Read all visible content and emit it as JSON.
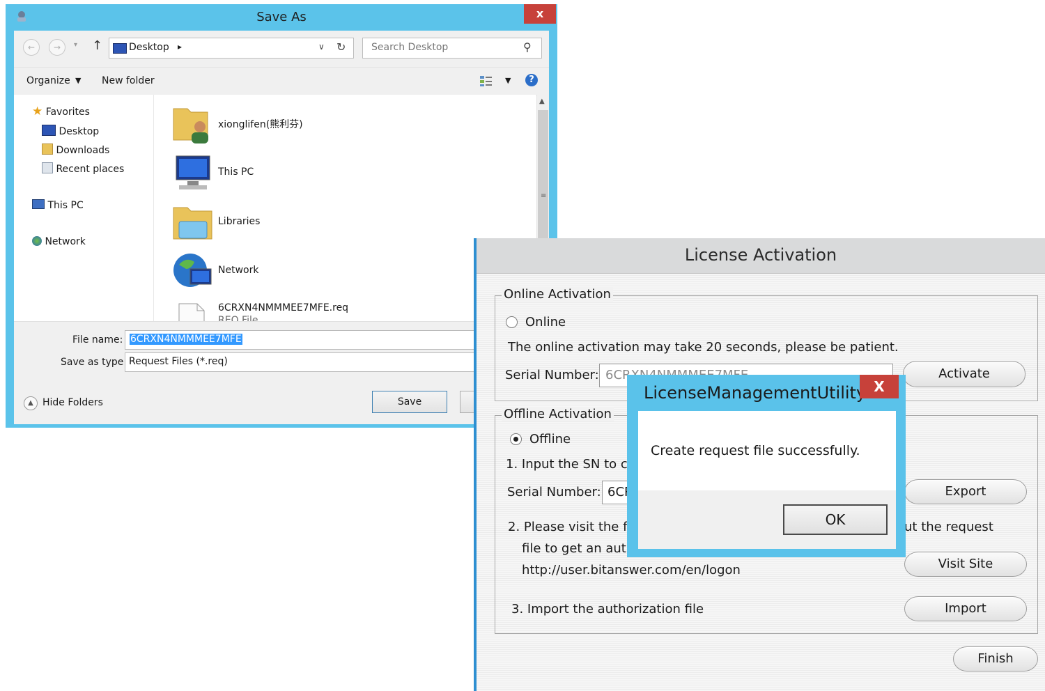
{
  "save_as": {
    "title": "Save As",
    "close": "x",
    "address": {
      "location": "Desktop",
      "chevron": "▸"
    },
    "search_placeholder": "Search Desktop",
    "toolbar": {
      "organize": "Organize",
      "new_folder": "New folder"
    },
    "nav": {
      "favorites": "Favorites",
      "desktop": "Desktop",
      "downloads": "Downloads",
      "recent": "Recent places",
      "this_pc": "This PC",
      "network": "Network"
    },
    "files": [
      {
        "name": "xionglifen(熊利芬)",
        "icon": "user-folder-icon"
      },
      {
        "name": "This PC",
        "icon": "computer-icon"
      },
      {
        "name": "Libraries",
        "icon": "libraries-icon"
      },
      {
        "name": "Network",
        "icon": "network-icon"
      },
      {
        "name": "6CRXN4NMMMEE7MFE.req",
        "sub": "REQ File",
        "icon": "file-icon"
      }
    ],
    "file_name_label": "File name:",
    "file_name_value": "6CRXN4NMMMEE7MFE",
    "save_type_label": "Save as type:",
    "save_type_value": "Request Files (*.req)",
    "hide_folders": "Hide Folders",
    "save_button": "Save"
  },
  "license": {
    "title": "License Activation",
    "online_group": "Online Activation",
    "online_radio": "Online",
    "online_note": "The online activation may take 20 seconds, please be patient.",
    "serial_label": "Serial Number:",
    "online_serial": "6CRXN4NMMMEE7MFE",
    "activate": "Activate",
    "offline_group": "Offline Activation",
    "offline_radio": "Offline",
    "step1": "1. Input the SN to cre",
    "offline_serial": "6CR",
    "export": "Export",
    "step2_a": "2. Please visit the fol",
    "step2_tail": "ut the request",
    "step2_b": "file to get an autho",
    "url": "http://user.bitanswer.com/en/logon",
    "visit_site": "Visit Site",
    "step3": "3. Import the authorization file",
    "import": "Import",
    "finish": "Finish"
  },
  "message_box": {
    "title": "LicenseManagementUtility",
    "close": "X",
    "message": "Create request file successfully.",
    "ok": "OK"
  }
}
